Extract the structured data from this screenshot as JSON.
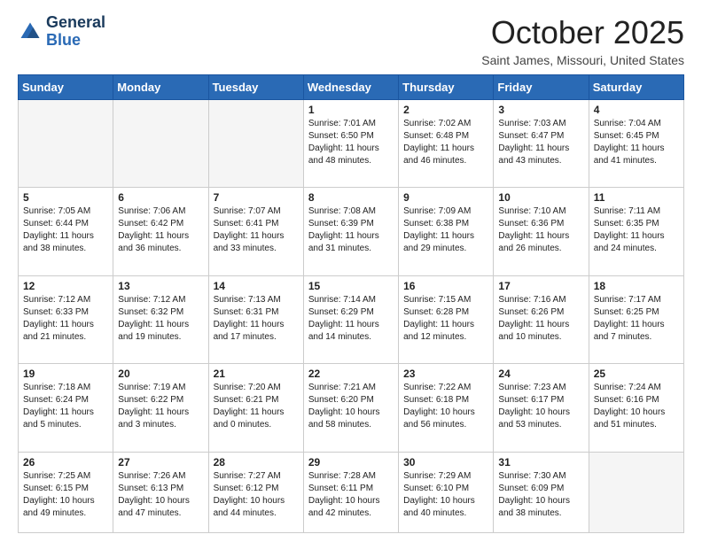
{
  "logo": {
    "line1": "General",
    "line2": "Blue"
  },
  "header": {
    "month": "October 2025",
    "location": "Saint James, Missouri, United States"
  },
  "weekdays": [
    "Sunday",
    "Monday",
    "Tuesday",
    "Wednesday",
    "Thursday",
    "Friday",
    "Saturday"
  ],
  "weeks": [
    [
      {
        "day": "",
        "info": ""
      },
      {
        "day": "",
        "info": ""
      },
      {
        "day": "",
        "info": ""
      },
      {
        "day": "1",
        "info": "Sunrise: 7:01 AM\nSunset: 6:50 PM\nDaylight: 11 hours\nand 48 minutes."
      },
      {
        "day": "2",
        "info": "Sunrise: 7:02 AM\nSunset: 6:48 PM\nDaylight: 11 hours\nand 46 minutes."
      },
      {
        "day": "3",
        "info": "Sunrise: 7:03 AM\nSunset: 6:47 PM\nDaylight: 11 hours\nand 43 minutes."
      },
      {
        "day": "4",
        "info": "Sunrise: 7:04 AM\nSunset: 6:45 PM\nDaylight: 11 hours\nand 41 minutes."
      }
    ],
    [
      {
        "day": "5",
        "info": "Sunrise: 7:05 AM\nSunset: 6:44 PM\nDaylight: 11 hours\nand 38 minutes."
      },
      {
        "day": "6",
        "info": "Sunrise: 7:06 AM\nSunset: 6:42 PM\nDaylight: 11 hours\nand 36 minutes."
      },
      {
        "day": "7",
        "info": "Sunrise: 7:07 AM\nSunset: 6:41 PM\nDaylight: 11 hours\nand 33 minutes."
      },
      {
        "day": "8",
        "info": "Sunrise: 7:08 AM\nSunset: 6:39 PM\nDaylight: 11 hours\nand 31 minutes."
      },
      {
        "day": "9",
        "info": "Sunrise: 7:09 AM\nSunset: 6:38 PM\nDaylight: 11 hours\nand 29 minutes."
      },
      {
        "day": "10",
        "info": "Sunrise: 7:10 AM\nSunset: 6:36 PM\nDaylight: 11 hours\nand 26 minutes."
      },
      {
        "day": "11",
        "info": "Sunrise: 7:11 AM\nSunset: 6:35 PM\nDaylight: 11 hours\nand 24 minutes."
      }
    ],
    [
      {
        "day": "12",
        "info": "Sunrise: 7:12 AM\nSunset: 6:33 PM\nDaylight: 11 hours\nand 21 minutes."
      },
      {
        "day": "13",
        "info": "Sunrise: 7:12 AM\nSunset: 6:32 PM\nDaylight: 11 hours\nand 19 minutes."
      },
      {
        "day": "14",
        "info": "Sunrise: 7:13 AM\nSunset: 6:31 PM\nDaylight: 11 hours\nand 17 minutes."
      },
      {
        "day": "15",
        "info": "Sunrise: 7:14 AM\nSunset: 6:29 PM\nDaylight: 11 hours\nand 14 minutes."
      },
      {
        "day": "16",
        "info": "Sunrise: 7:15 AM\nSunset: 6:28 PM\nDaylight: 11 hours\nand 12 minutes."
      },
      {
        "day": "17",
        "info": "Sunrise: 7:16 AM\nSunset: 6:26 PM\nDaylight: 11 hours\nand 10 minutes."
      },
      {
        "day": "18",
        "info": "Sunrise: 7:17 AM\nSunset: 6:25 PM\nDaylight: 11 hours\nand 7 minutes."
      }
    ],
    [
      {
        "day": "19",
        "info": "Sunrise: 7:18 AM\nSunset: 6:24 PM\nDaylight: 11 hours\nand 5 minutes."
      },
      {
        "day": "20",
        "info": "Sunrise: 7:19 AM\nSunset: 6:22 PM\nDaylight: 11 hours\nand 3 minutes."
      },
      {
        "day": "21",
        "info": "Sunrise: 7:20 AM\nSunset: 6:21 PM\nDaylight: 11 hours\nand 0 minutes."
      },
      {
        "day": "22",
        "info": "Sunrise: 7:21 AM\nSunset: 6:20 PM\nDaylight: 10 hours\nand 58 minutes."
      },
      {
        "day": "23",
        "info": "Sunrise: 7:22 AM\nSunset: 6:18 PM\nDaylight: 10 hours\nand 56 minutes."
      },
      {
        "day": "24",
        "info": "Sunrise: 7:23 AM\nSunset: 6:17 PM\nDaylight: 10 hours\nand 53 minutes."
      },
      {
        "day": "25",
        "info": "Sunrise: 7:24 AM\nSunset: 6:16 PM\nDaylight: 10 hours\nand 51 minutes."
      }
    ],
    [
      {
        "day": "26",
        "info": "Sunrise: 7:25 AM\nSunset: 6:15 PM\nDaylight: 10 hours\nand 49 minutes."
      },
      {
        "day": "27",
        "info": "Sunrise: 7:26 AM\nSunset: 6:13 PM\nDaylight: 10 hours\nand 47 minutes."
      },
      {
        "day": "28",
        "info": "Sunrise: 7:27 AM\nSunset: 6:12 PM\nDaylight: 10 hours\nand 44 minutes."
      },
      {
        "day": "29",
        "info": "Sunrise: 7:28 AM\nSunset: 6:11 PM\nDaylight: 10 hours\nand 42 minutes."
      },
      {
        "day": "30",
        "info": "Sunrise: 7:29 AM\nSunset: 6:10 PM\nDaylight: 10 hours\nand 40 minutes."
      },
      {
        "day": "31",
        "info": "Sunrise: 7:30 AM\nSunset: 6:09 PM\nDaylight: 10 hours\nand 38 minutes."
      },
      {
        "day": "",
        "info": ""
      }
    ]
  ]
}
